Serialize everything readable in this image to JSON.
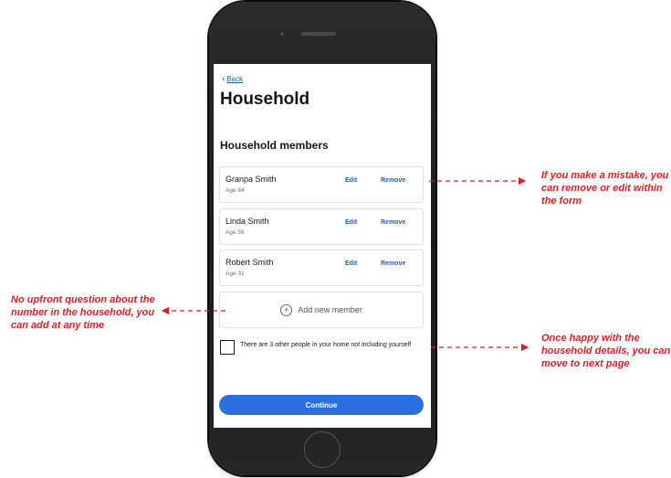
{
  "screen": {
    "back_label": "Back",
    "title": "Household",
    "section_title": "Household members",
    "members": [
      {
        "name": "Granpa Smith",
        "age": "Age 84",
        "edit": "Edit",
        "remove": "Remove"
      },
      {
        "name": "Linda Smith",
        "age": "Age 56",
        "edit": "Edit",
        "remove": "Remove"
      },
      {
        "name": "Robert Smith",
        "age": "Age 31",
        "edit": "Edit",
        "remove": "Remove"
      }
    ],
    "add_member_label": "Add new member",
    "checkbox_label": "There are 3 other people in your home not including yourself",
    "checkbox_checked": false,
    "continue_label": "Continue"
  },
  "annotations": {
    "remove_edit": "If you make a mistake, you can remove or edit within the form",
    "no_upfront": "No upfront question about the number in the household, you can add at any time",
    "next_page": "Once happy with the household details, you can move to next page"
  },
  "colors": {
    "accent": "#2a6ee0",
    "link": "#1f5fb8",
    "annotation": "#e31b23"
  },
  "icons": {
    "back": "chevron-left-icon",
    "add": "plus-circle-icon"
  }
}
